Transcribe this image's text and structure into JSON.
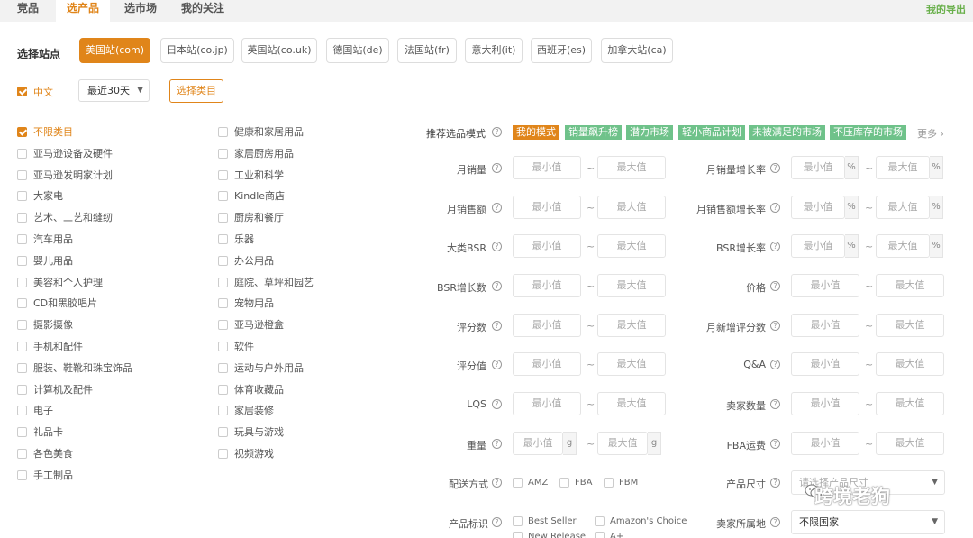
{
  "tabs": [
    "竞品",
    "选产品",
    "选市场",
    "我的关注"
  ],
  "active_tab": 1,
  "export_label": "我的导出",
  "site": {
    "label": "选择站点",
    "options": [
      "美国站(com)",
      "日本站(co.jp)",
      "英国站(co.uk)",
      "德国站(de)",
      "法国站(fr)",
      "意大利(it)",
      "西班牙(es)",
      "加拿大站(ca)"
    ],
    "selected": 0
  },
  "language": {
    "label": "中文",
    "checked": true
  },
  "period": {
    "value": "最近30天"
  },
  "choose_category_label": "选择类目",
  "categories": {
    "col1": [
      "不限类目",
      "亚马逊设备及硬件",
      "亚马逊发明家计划",
      "大家电",
      "艺术、工艺和缝纫",
      "汽车用品",
      "婴儿用品",
      "美容和个人护理",
      "CD和黑胶唱片",
      "摄影摄像",
      "手机和配件",
      "服装、鞋靴和珠宝饰品",
      "计算机及配件",
      "电子",
      "礼品卡",
      "各色美食",
      "手工制品"
    ],
    "col2": [
      "健康和家居用品",
      "家居厨房用品",
      "工业和科学",
      "Kindle商店",
      "厨房和餐厅",
      "乐器",
      "办公用品",
      "庭院、草坪和园艺",
      "宠物用品",
      "亚马逊橙盒",
      "软件",
      "运动与户外用品",
      "体育收藏品",
      "家居装修",
      "玩具与游戏",
      "视频游戏"
    ],
    "checked": "不限类目"
  },
  "mode": {
    "label": "推荐选品模式",
    "tags": [
      "我的模式",
      "销量飙升榜",
      "潜力市场",
      "轻小商品计划",
      "未被满足的市场",
      "不压库存的市场"
    ],
    "active": 0,
    "more_label": "更多"
  },
  "placeholders": {
    "min": "最小值",
    "max": "最大值",
    "size": "请选择产品尺寸"
  },
  "units": {
    "percent": "%",
    "gram": "g"
  },
  "tilde": "~",
  "filters_left": [
    "月销量",
    "月销售额",
    "大类BSR",
    "BSR增长数",
    "评分数",
    "评分值",
    "LQS",
    "重量"
  ],
  "filters_right": [
    "月销量增长率",
    "月销售额增长率",
    "BSR增长率",
    "价格",
    "月新增评分数",
    "Q&A",
    "卖家数量",
    "FBA运费"
  ],
  "delivery": {
    "label": "配送方式",
    "options": [
      "AMZ",
      "FBA",
      "FBM"
    ]
  },
  "product_size_label": "产品尺寸",
  "product_tags": {
    "label": "产品标识",
    "options": [
      "Best Seller",
      "Amazon's Choice",
      "New Release",
      "A+"
    ]
  },
  "seller_location": {
    "label": "卖家所属地",
    "value": "不限国家"
  },
  "watermark": "跨境老狗",
  "colors": {
    "accent": "#e0851a",
    "tag_green": "#6fc28a",
    "export_green": "#6ab04c"
  }
}
